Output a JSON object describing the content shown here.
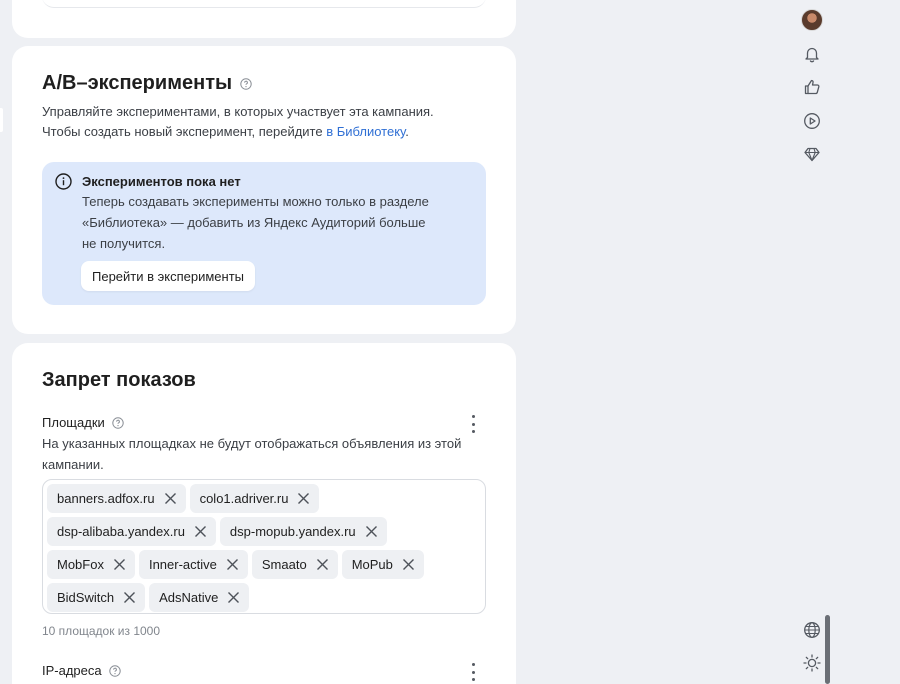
{
  "ab_section": {
    "title": "A/B–эксперименты",
    "desc_line1": "Управляйте экспериментами, в которых участвует эта кампания.",
    "desc_line2_prefix": "Чтобы создать новый эксперимент, перейдите ",
    "desc_link": "в Библиотеку",
    "desc_line2_suffix": ".",
    "info_title": "Экспериментов пока нет",
    "info_text_line1": "Теперь создавать эксперименты можно только в разделе",
    "info_text_line2": "«Библиотека» — добавить из Яндекс Аудиторий больше",
    "info_text_line3": "не получится.",
    "goto_button": "Перейти в эксперименты"
  },
  "ban_section": {
    "title": "Запрет показов",
    "platforms_label": "Площадки",
    "platforms_desc_line1": "На указанных площадках не будут отображаться объявления из этой",
    "platforms_desc_line2": "кампании.",
    "tags": [
      [
        "banners.adfox.ru",
        "colo1.adriver.ru"
      ],
      [
        "dsp-alibaba.yandex.ru",
        "dsp-mopub.yandex.ru"
      ],
      [
        "MobFox",
        "Inner-active",
        "Smaato",
        "MoPub"
      ],
      [
        "BidSwitch",
        "AdsNative"
      ]
    ],
    "counter": "10 площадок из 1000",
    "ip_label": "IP-адреса"
  },
  "right_rail": {
    "icons": [
      "avatar",
      "bell-icon",
      "thumbs-up-icon",
      "play-icon",
      "diamond-icon",
      "globe-icon",
      "sun-icon"
    ]
  },
  "colors": {
    "page_bg": "#eef0f4",
    "card_bg": "#ffffff",
    "info_bg": "#dde8fb",
    "link": "#2f6fd4",
    "tag_bg": "#eef0f3"
  }
}
